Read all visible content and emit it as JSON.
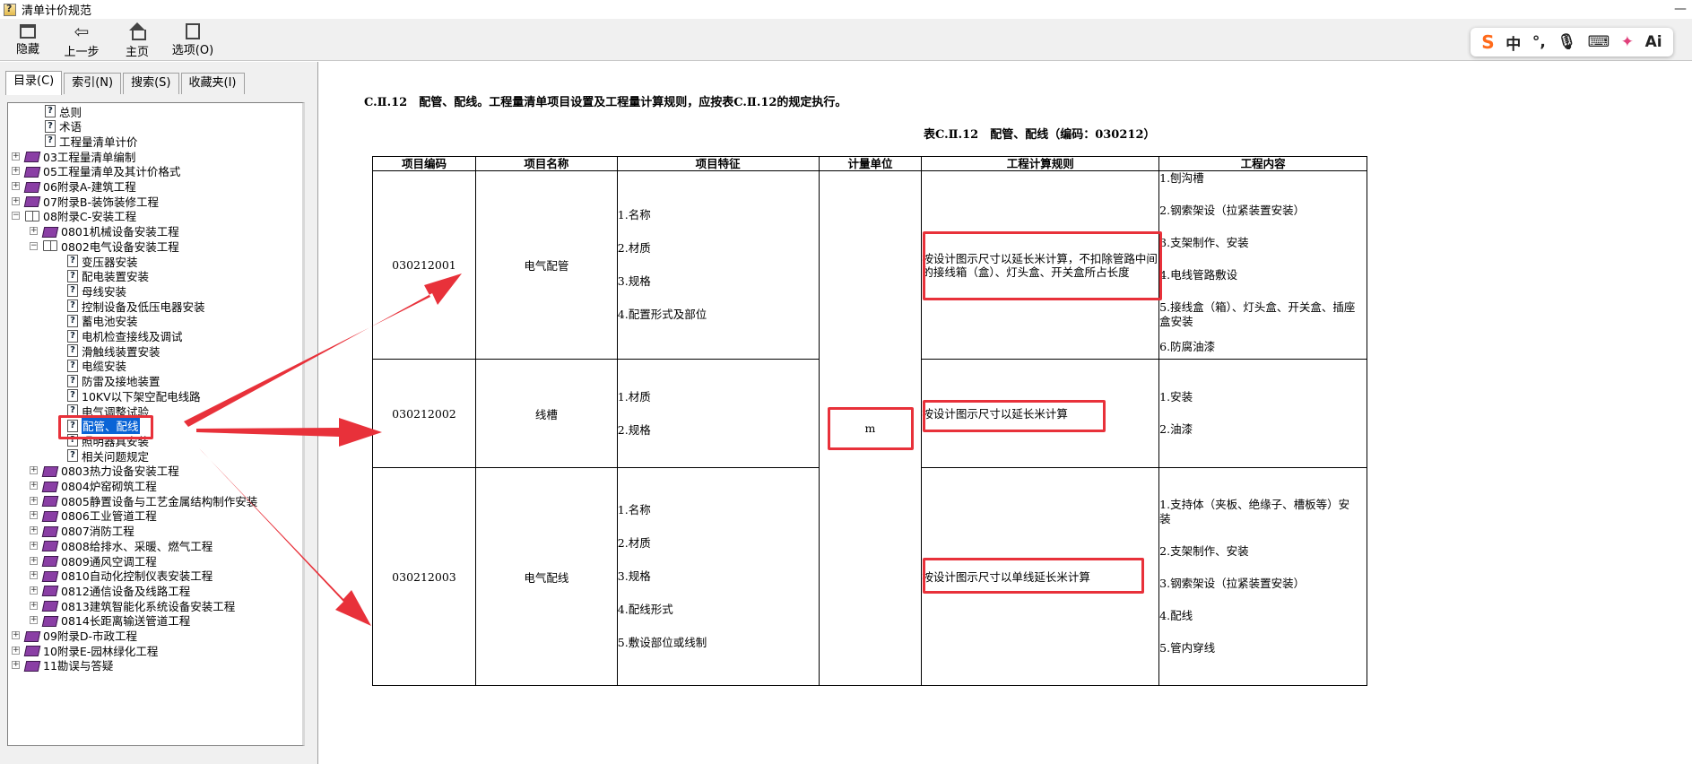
{
  "window": {
    "title": "清单计价规范"
  },
  "toolbar": {
    "buttons": [
      {
        "label": "隐藏",
        "icon": "hide-icon"
      },
      {
        "label": "上一步",
        "icon": "back-arrow-icon"
      },
      {
        "label": "主页",
        "icon": "home-icon"
      },
      {
        "label": "选项(O)",
        "icon": "options-icon"
      }
    ]
  },
  "ime": {
    "items": [
      "S",
      "中",
      "°,",
      "🎙",
      "⌨",
      "✦",
      "Ai"
    ]
  },
  "tabs": [
    "目录(C)",
    "索引(N)",
    "搜索(S)",
    "收藏夹(I)"
  ],
  "tree": [
    {
      "label": "总则",
      "type": "page",
      "level": 1
    },
    {
      "label": "术语",
      "type": "page",
      "level": 1
    },
    {
      "label": "工程量清单计价",
      "type": "page",
      "level": 1
    },
    {
      "label": "03工程量清单编制",
      "type": "book",
      "level": 0,
      "expander": "+"
    },
    {
      "label": "05工程量清单及其计价格式",
      "type": "book",
      "level": 0,
      "expander": "+"
    },
    {
      "label": "06附录A-建筑工程",
      "type": "book",
      "level": 0,
      "expander": "+"
    },
    {
      "label": "07附录B-装饰装修工程",
      "type": "book",
      "level": 0,
      "expander": "+"
    },
    {
      "label": "08附录C-安装工程",
      "type": "open",
      "level": 0,
      "expander": "-"
    },
    {
      "label": "0801机械设备安装工程",
      "type": "book",
      "level": 1,
      "expander": "+"
    },
    {
      "label": "0802电气设备安装工程",
      "type": "open",
      "level": 1,
      "expander": "-"
    },
    {
      "label": "变压器安装",
      "type": "page",
      "level": 2
    },
    {
      "label": "配电装置安装",
      "type": "page",
      "level": 2
    },
    {
      "label": "母线安装",
      "type": "page",
      "level": 2
    },
    {
      "label": "控制设备及低压电器安装",
      "type": "page",
      "level": 2
    },
    {
      "label": "蓄电池安装",
      "type": "page",
      "level": 2
    },
    {
      "label": "电机检查接线及调试",
      "type": "page",
      "level": 2
    },
    {
      "label": "滑触线装置安装",
      "type": "page",
      "level": 2
    },
    {
      "label": "电缆安装",
      "type": "page",
      "level": 2
    },
    {
      "label": "防雷及接地装置",
      "type": "page",
      "level": 2
    },
    {
      "label": "10KV以下架空配电线路",
      "type": "page",
      "level": 2
    },
    {
      "label": "电气调整试验",
      "type": "page",
      "level": 2
    },
    {
      "label": "配管、配线",
      "type": "page",
      "level": 2,
      "selected": true
    },
    {
      "label": "照明器具安装",
      "type": "page",
      "level": 2
    },
    {
      "label": "相关问题规定",
      "type": "page",
      "level": 2
    },
    {
      "label": "0803热力设备安装工程",
      "type": "book",
      "level": 1,
      "expander": "+"
    },
    {
      "label": "0804炉窑砌筑工程",
      "type": "book",
      "level": 1,
      "expander": "+"
    },
    {
      "label": "0805静置设备与工艺金属结构制作安装",
      "type": "book",
      "level": 1,
      "expander": "+"
    },
    {
      "label": "0806工业管道工程",
      "type": "book",
      "level": 1,
      "expander": "+"
    },
    {
      "label": "0807消防工程",
      "type": "book",
      "level": 1,
      "expander": "+"
    },
    {
      "label": "0808给排水、采暖、燃气工程",
      "type": "book",
      "level": 1,
      "expander": "+"
    },
    {
      "label": "0809通风空调工程",
      "type": "book",
      "level": 1,
      "expander": "+"
    },
    {
      "label": "0810自动化控制仪表安装工程",
      "type": "book",
      "level": 1,
      "expander": "+"
    },
    {
      "label": "0812通信设备及线路工程",
      "type": "book",
      "level": 1,
      "expander": "+"
    },
    {
      "label": "0813建筑智能化系统设备安装工程",
      "type": "book",
      "level": 1,
      "expander": "+"
    },
    {
      "label": "0814长距离输送管道工程",
      "type": "book",
      "level": 1,
      "expander": "+"
    },
    {
      "label": "09附录D-市政工程",
      "type": "book",
      "level": 0,
      "expander": "+"
    },
    {
      "label": "10附录E-园林绿化工程",
      "type": "book",
      "level": 0,
      "expander": "+"
    },
    {
      "label": "11勘误与答疑",
      "type": "book",
      "level": 0,
      "expander": "+"
    }
  ],
  "doc": {
    "heading": "C.Ⅱ.12　配管、配线。工程量清单项目设置及工程量计算规则，应按表C.Ⅱ.12的规定执行。",
    "table_caption": "表C.Ⅱ.12　配管、配线（编码：030212）",
    "columns": [
      "项目编码",
      "项目名称",
      "项目特征",
      "计量单位",
      "工程计算规则",
      "工程内容"
    ],
    "unit": "m",
    "rows": [
      {
        "code": "030212001",
        "name": "电气配管",
        "features": [
          "1.名称",
          "2.材质",
          "3.规格",
          "4.配置形式及部位"
        ],
        "rule": "按设计图示尺寸以延长米计算，不扣除管路中间的接线箱（盒）、灯头盒、开关盒所占长度",
        "content": [
          "1.刨沟槽",
          "2.钢索架设（拉紧装置安装）",
          "3.支架制作、安装",
          "4.电线管路敷设",
          "5.接线盒（箱）、灯头盒、开关盒、插座盒安装",
          "6.防腐油漆"
        ]
      },
      {
        "code": "030212002",
        "name": "线槽",
        "features": [
          "1.材质",
          "2.规格"
        ],
        "rule": "按设计图示尺寸以延长米计算",
        "content": [
          "1.安装",
          "2.油漆"
        ]
      },
      {
        "code": "030212003",
        "name": "电气配线",
        "features": [
          "1.名称",
          "2.材质",
          "3.规格",
          "4.配线形式",
          "5.敷设部位或线制"
        ],
        "rule": "按设计图示尺寸以单线延长米计算",
        "content": [
          "1.支持体（夹板、绝缘子、槽板等）安装",
          "2.支架制作、安装",
          "3.钢索架设（拉紧装置安装）",
          "4.配线",
          "5.管内穿线"
        ]
      }
    ]
  },
  "colors": {
    "highlight": "#e8313a",
    "selection": "#0a64d6"
  }
}
